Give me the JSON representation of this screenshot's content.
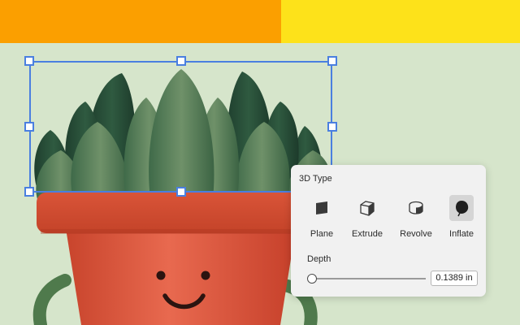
{
  "banner": {
    "left_color": "#fb9f00",
    "right_color": "#fde21a"
  },
  "canvas": {
    "background_color": "#d6e5cb",
    "artwork": "potted-succulent-character",
    "selection_color": "#4a7fe0"
  },
  "panel": {
    "title": "3D Type",
    "types": [
      {
        "label": "Plane",
        "icon": "plane-icon",
        "selected": false
      },
      {
        "label": "Extrude",
        "icon": "extrude-icon",
        "selected": false
      },
      {
        "label": "Revolve",
        "icon": "revolve-icon",
        "selected": false
      },
      {
        "label": "Inflate",
        "icon": "inflate-icon",
        "selected": true
      }
    ],
    "depth": {
      "label": "Depth",
      "value": "0.1389 in",
      "slider_fraction": 0.0
    }
  }
}
